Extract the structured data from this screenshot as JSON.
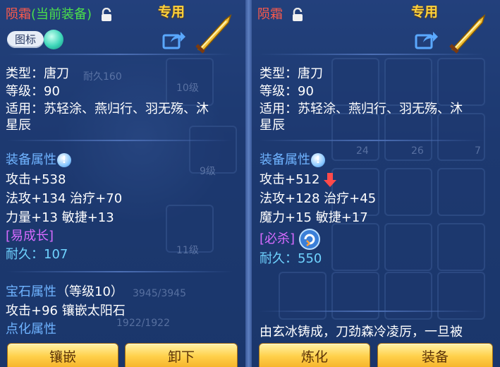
{
  "left_panel": {
    "name": "陨霜",
    "equipped_tag": "(当前装备)",
    "exclusive": "专用",
    "icon_toggle_label": "图标",
    "type": "类型：唐刀",
    "level": "等级：90",
    "usable_line1": "适用：苏轻涂、燕归行、羽无殇、沐",
    "usable_line2": "星辰",
    "equip_attr_title": "装备属性",
    "attack": "攻击+538",
    "magic_heal": "法攻+134 治疗+70",
    "str_agi": "力量+13 敏捷+13",
    "special": "[易成长]",
    "durability_label": "耐久：",
    "durability_value": "107",
    "gem_title": "宝石属性",
    "gem_level": "（等级10）",
    "gem_line": "攻击+96 镶嵌太阳石",
    "refine_title": "点化属性",
    "btn_left": "镶嵌",
    "btn_right": "卸下"
  },
  "right_panel": {
    "name": "陨霜",
    "exclusive": "专用",
    "type": "类型：唐刀",
    "level": "等级：90",
    "usable_line1": "适用：苏轻涂、燕归行、羽无殇、沐",
    "usable_line2": "星辰",
    "equip_attr_title": "装备属性",
    "attack": "攻击+512",
    "magic_heal": "法攻+128 治疗+45",
    "int_agi": "魔力+15 敏捷+17",
    "special": "[必杀]",
    "durability_label": "耐久：",
    "durability_value": "550",
    "description": "由玄冰铸成，刀劲森冷凌厉，一旦被",
    "btn_left": "炼化",
    "btn_right": "装备"
  },
  "background": {
    "durability_ghost": "耐久160",
    "level10": "10级",
    "level9": "9级",
    "level11": "11级",
    "hp": "3945/3945",
    "mp": "1922/1922",
    "count24": "24",
    "count26": "26",
    "count7": "7"
  },
  "colors": {
    "item_name": "#ff5a4a",
    "equipped": "#4be04b",
    "exclusive": "#ffd23a",
    "section": "#6fb3ff",
    "special": "#d66bff",
    "durability": "#6fd3ff",
    "button": "#ffd04a"
  },
  "icons": [
    "lock-icon",
    "share-icon",
    "weapon-icon",
    "info-icon",
    "down-arrow-icon",
    "crit-skill-icon"
  ]
}
